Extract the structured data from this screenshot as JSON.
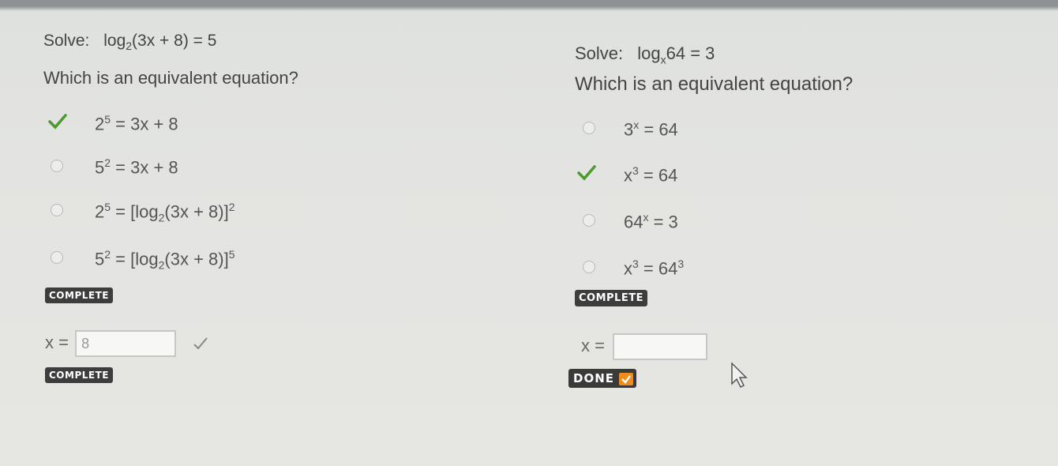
{
  "left": {
    "title_prefix": "Solve:",
    "title_eq": "log",
    "title_base": "2",
    "title_arg": "(3x + 8) = 5",
    "prompt": "Which is an equivalent equation?",
    "options": [
      {
        "base": "2",
        "exp": "5",
        "rest": " = 3x + 8",
        "state": "correct"
      },
      {
        "base": "5",
        "exp": "2",
        "rest": " = 3x + 8",
        "state": "unselected"
      },
      {
        "base": "2",
        "exp": "5",
        "rest": " = [log",
        "sub": "2",
        "rest2": "(3x + 8)]",
        "exp2": "2",
        "state": "unselected"
      },
      {
        "base": "5",
        "exp": "2",
        "rest": " = [log",
        "sub": "2",
        "rest2": "(3x + 8)]",
        "exp2": "5",
        "state": "unselected"
      }
    ],
    "badge1": "COMPLETE",
    "answer_label": "x =",
    "answer_value": "8",
    "badge2": "COMPLETE"
  },
  "right": {
    "title_prefix": "Solve:",
    "title_eq": "log",
    "title_base": "x",
    "title_arg": "64 = 3",
    "prompt": "Which is an equivalent equation?",
    "options": [
      {
        "base": "3",
        "exp": "x",
        "rest": " = 64",
        "state": "unselected"
      },
      {
        "base": "x",
        "exp": "3",
        "rest": " = 64",
        "state": "correct"
      },
      {
        "base": "64",
        "exp": "x",
        "rest": " = 3",
        "state": "unselected"
      },
      {
        "base": "x",
        "exp": "3",
        "rest": " = 64",
        "exp2": "3",
        "state": "unselected"
      }
    ],
    "badge1": "COMPLETE",
    "answer_label": "x =",
    "answer_value": "",
    "done_label": "DONE"
  },
  "colors": {
    "check": "#4b9a2e",
    "done_accent": "#f08c1b",
    "badge_bg": "#3d3d3d"
  },
  "icons": [
    "checkmark-icon",
    "radio-button-icon",
    "mouse-cursor-icon"
  ]
}
